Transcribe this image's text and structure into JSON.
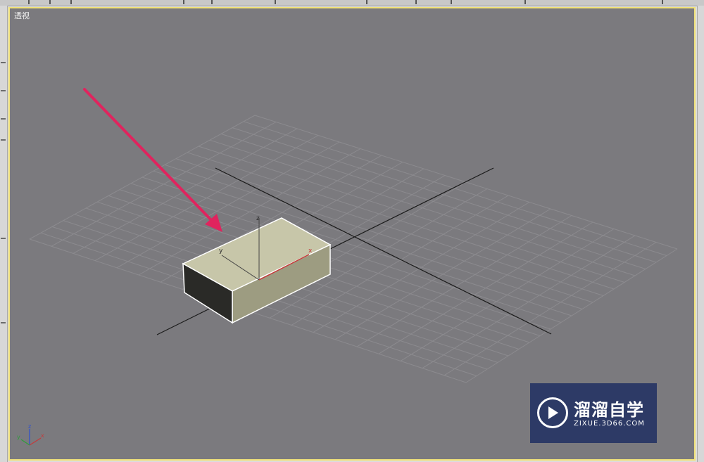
{
  "viewport": {
    "label": "透视",
    "active_border_color": "#f2e37a",
    "background_color": "#7b7a7e"
  },
  "object": {
    "type": "box",
    "pivot_axes": {
      "x": "x",
      "y": "y",
      "z": "z"
    }
  },
  "axis_tripod": {
    "x": "x",
    "y": "y",
    "z": "z"
  },
  "annotation": {
    "arrow_color": "#e0245e"
  },
  "watermark": {
    "title": "溜溜自学",
    "subtitle": "ZIXUE.3D66.COM",
    "background_color": "#2d3a66"
  }
}
